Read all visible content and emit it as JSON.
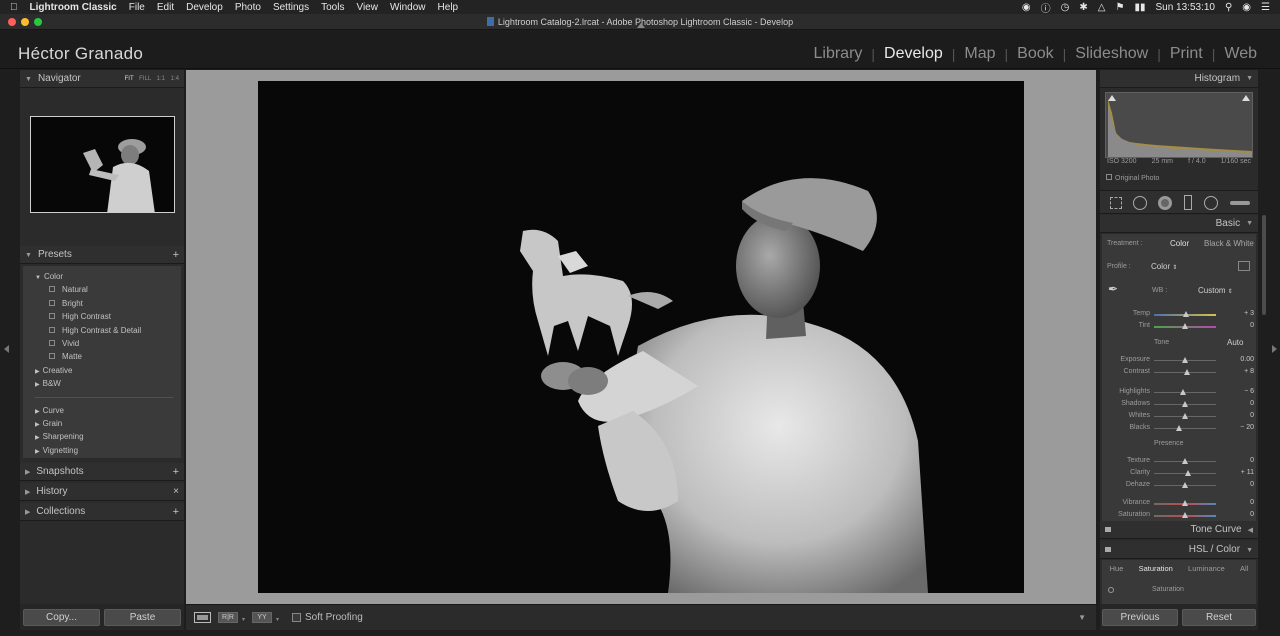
{
  "menubar": {
    "app_name": "Lightroom Classic",
    "items": [
      "File",
      "Edit",
      "Develop",
      "Photo",
      "Settings",
      "Tools",
      "View",
      "Window",
      "Help"
    ],
    "clock": "Sun 13:53:10"
  },
  "window": {
    "title": "Lightroom Catalog-2.lrcat - Adobe Photoshop Lightroom Classic - Develop"
  },
  "identity": {
    "plate": "Héctor Granado",
    "modules": [
      "Library",
      "Develop",
      "Map",
      "Book",
      "Slideshow",
      "Print",
      "Web"
    ],
    "active_module": "Develop"
  },
  "left": {
    "navigator": {
      "title": "Navigator",
      "zoom_options": [
        "FIT",
        "FILL",
        "1:1",
        "1:4"
      ]
    },
    "presets": {
      "title": "Presets",
      "groups": [
        {
          "name": "Color",
          "expanded": true,
          "items": [
            "Natural",
            "Bright",
            "High Contrast",
            "High Contrast & Detail",
            "Vivid",
            "Matte"
          ]
        },
        {
          "name": "Creative",
          "expanded": false,
          "items": []
        },
        {
          "name": "B&W",
          "expanded": false,
          "items": []
        }
      ],
      "groups2": [
        "Curve",
        "Grain",
        "Sharpening",
        "Vignetting"
      ]
    },
    "snapshots": "Snapshots",
    "history": "History",
    "collections": "Collections",
    "copy_label": "Copy...",
    "paste_label": "Paste"
  },
  "toolbar": {
    "soft_proofing": "Soft Proofing"
  },
  "right": {
    "histogram": {
      "title": "Histogram",
      "iso": "ISO 3200",
      "focal": "25 mm",
      "aperture": "f / 4.0",
      "shutter": "1/160 sec",
      "original": "Original Photo"
    },
    "basic": {
      "title": "Basic",
      "treatment_label": "Treatment :",
      "treatment_color": "Color",
      "treatment_bw": "Black & White",
      "profile_label": "Profile :",
      "profile_value": "Color",
      "wb_label": "WB :",
      "wb_value": "Custom",
      "tone_label": "Tone",
      "auto_label": "Auto",
      "presence_label": "Presence",
      "sliders": [
        {
          "name": "Temp",
          "value": "+ 3",
          "pos": 0.52
        },
        {
          "name": "Tint",
          "value": "0",
          "pos": 0.5
        },
        {
          "name": "Exposure",
          "value": "0.00",
          "pos": 0.5
        },
        {
          "name": "Contrast",
          "value": "+ 8",
          "pos": 0.54
        },
        {
          "name": "Highlights",
          "value": "− 6",
          "pos": 0.47
        },
        {
          "name": "Shadows",
          "value": "0",
          "pos": 0.5
        },
        {
          "name": "Whites",
          "value": "0",
          "pos": 0.5
        },
        {
          "name": "Blacks",
          "value": "− 20",
          "pos": 0.4
        },
        {
          "name": "Texture",
          "value": "0",
          "pos": 0.5
        },
        {
          "name": "Clarity",
          "value": "+ 11",
          "pos": 0.55
        },
        {
          "name": "Dehaze",
          "value": "0",
          "pos": 0.5
        },
        {
          "name": "Vibrance",
          "value": "0",
          "pos": 0.5
        },
        {
          "name": "Saturation",
          "value": "0",
          "pos": 0.5
        }
      ]
    },
    "tone_curve": "Tone Curve",
    "hsl": {
      "title": "HSL / Color",
      "tabs": [
        "Hue",
        "Saturation",
        "Luminance",
        "All"
      ],
      "active_tab": "Saturation",
      "section": "Saturation"
    },
    "previous_label": "Previous",
    "reset_label": "Reset"
  },
  "colors": {
    "panel": "#2b2b2b",
    "header": "#2f2f2f",
    "accent": "#e8e8e8"
  }
}
